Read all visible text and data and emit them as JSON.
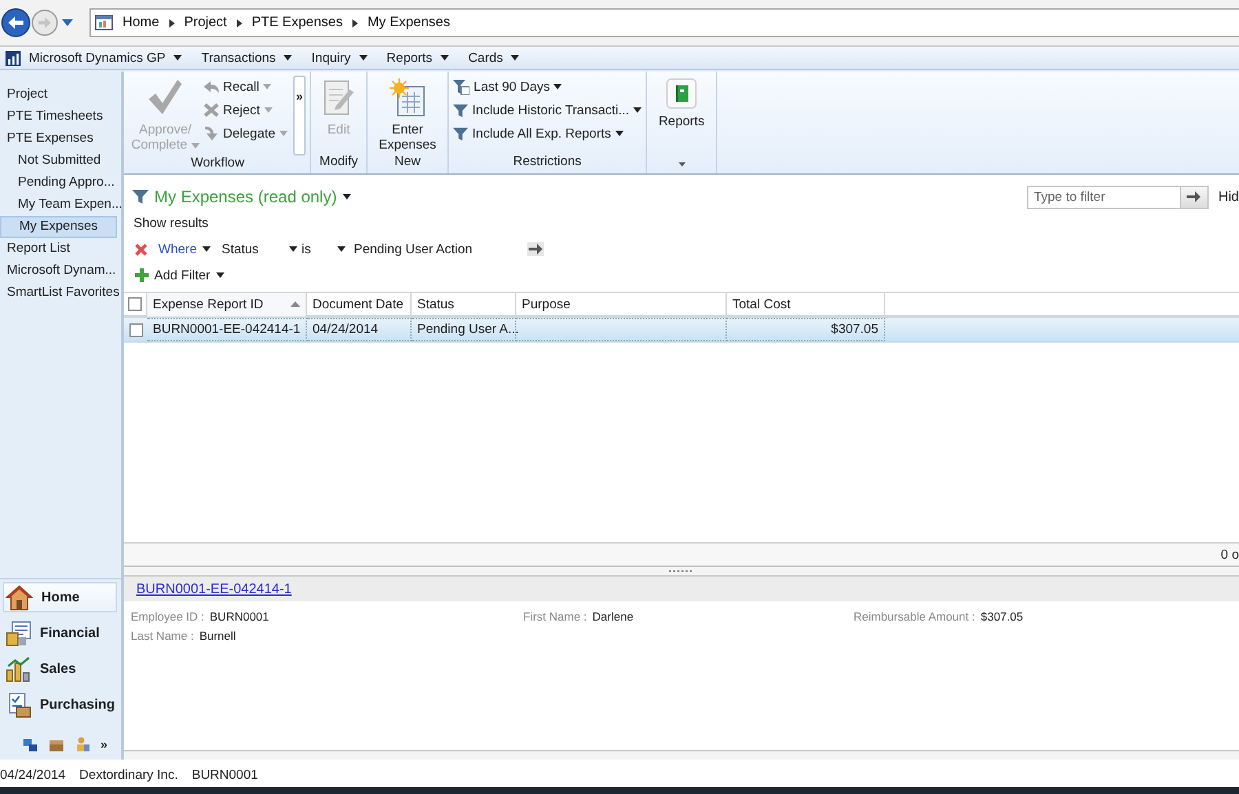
{
  "navigation": {
    "breadcrumbs": [
      "Home",
      "Project",
      "PTE Expenses",
      "My Expenses"
    ]
  },
  "menu_bar": [
    {
      "label": "Microsoft Dynamics GP",
      "kind": "app"
    },
    {
      "label": "Transactions",
      "kind": "menu"
    },
    {
      "label": "Inquiry",
      "kind": "menu"
    },
    {
      "label": "Reports",
      "kind": "menu"
    },
    {
      "label": "Cards",
      "kind": "menu"
    }
  ],
  "sidebar": {
    "items": [
      {
        "label": "Project",
        "selected": false
      },
      {
        "label": "PTE Timesheets",
        "selected": false
      },
      {
        "label": "PTE Expenses",
        "selected": false,
        "children": [
          {
            "label": "Not Submitted",
            "selected": false
          },
          {
            "label": "Pending Appro...",
            "selected": false
          },
          {
            "label": "My Team Expen...",
            "selected": false
          },
          {
            "label": "My Expenses",
            "selected": true
          }
        ]
      },
      {
        "label": "Report List",
        "selected": false
      },
      {
        "label": "Microsoft Dynam...",
        "selected": false
      },
      {
        "label": "SmartList Favorites",
        "selected": false
      }
    ],
    "nav_buttons": [
      {
        "label": "Home",
        "selected": true
      },
      {
        "label": "Financial",
        "selected": false
      },
      {
        "label": "Sales",
        "selected": false
      },
      {
        "label": "Purchasing",
        "selected": false
      }
    ],
    "more_label": "»"
  },
  "ribbon": [
    {
      "label": "Workflow",
      "items": [
        {
          "label": "Approve/ Complete",
          "kind": "large",
          "disabled": true,
          "dropdown": true
        },
        {
          "label": "Recall",
          "kind": "small",
          "disabled": true,
          "dropdown": true
        },
        {
          "label": "Reject",
          "kind": "small",
          "disabled": true,
          "dropdown": true
        },
        {
          "label": "Delegate",
          "kind": "small",
          "disabled": true,
          "dropdown": true
        },
        {
          "label": "»",
          "kind": "overflow",
          "disabled": false
        }
      ]
    },
    {
      "label": "Modify",
      "items": [
        {
          "label": "Edit",
          "kind": "large",
          "disabled": true,
          "dropdown": false
        }
      ]
    },
    {
      "label": "New",
      "items": [
        {
          "label": "Enter Expenses",
          "kind": "large",
          "disabled": false,
          "dropdown": false
        }
      ]
    },
    {
      "label": "Restrictions",
      "items": [
        {
          "label": "Last 90 Days",
          "kind": "small",
          "disabled": false,
          "dropdown": true
        },
        {
          "label": "Include Historic Transacti...",
          "kind": "small",
          "disabled": false,
          "dropdown": true
        },
        {
          "label": "Include All Exp. Reports",
          "kind": "small",
          "disabled": false,
          "dropdown": true
        }
      ]
    },
    {
      "launcher": true,
      "items": [
        {
          "label": "Reports",
          "kind": "large",
          "disabled": false,
          "dropdown": false
        }
      ]
    }
  ],
  "list": {
    "title": "My Expenses (read only)",
    "filter_placeholder": "Type to filter",
    "hide_label": "Hid",
    "show_results": "Show results",
    "filter": {
      "where": "Where",
      "field": "Status",
      "operator": "is",
      "value": "Pending User Action"
    },
    "add_filter": "Add Filter",
    "table": {
      "header_checked": false,
      "columns": [
        {
          "label": "Expense Report ID",
          "sorted": true
        },
        {
          "label": "Document Date",
          "sorted": false
        },
        {
          "label": "Status",
          "sorted": false
        },
        {
          "label": "Purpose",
          "sorted": false
        },
        {
          "label": "Total Cost",
          "sorted": false
        }
      ],
      "rows": [
        {
          "selected": true,
          "checked": false,
          "cells": [
            "BURN0001-EE-042414-1",
            "04/24/2014",
            "Pending User A...",
            null,
            "$307.05"
          ]
        }
      ]
    },
    "count": "0 o"
  },
  "detail": {
    "link": "BURN0001-EE-042414-1",
    "fields": [
      {
        "label": "Employee ID :",
        "value": "BURN0001"
      },
      {
        "label": "First Name :",
        "value": "Darlene"
      },
      {
        "label": "Reimbursable Amount :",
        "value": "$307.05"
      },
      {
        "label": "Last Name :",
        "value": "Burnell"
      }
    ]
  },
  "status_bar": [
    "04/24/2014",
    "Dextordinary Inc.",
    "BURN0001"
  ]
}
